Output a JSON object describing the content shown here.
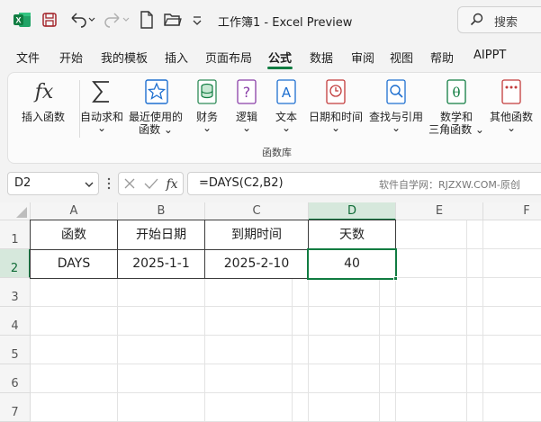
{
  "window": {
    "title": "工作簿1 - Excel Preview",
    "search_label": "搜索",
    "icons": [
      "excel-logo-icon",
      "save-icon",
      "undo-icon",
      "redo-icon",
      "new-file-icon",
      "open-folder-icon",
      "customize-qat-icon",
      "search-icon"
    ]
  },
  "menu": {
    "tabs": [
      "文件",
      "开始",
      "我的模板",
      "插入",
      "页面布局",
      "公式",
      "数据",
      "审阅",
      "视图",
      "帮助",
      "AIPPT"
    ],
    "active": "公式"
  },
  "ribbon": {
    "buttons": [
      {
        "label": "插入函数",
        "label2": "",
        "icon": "fx-icon"
      },
      {
        "label": "自动求和",
        "label2": "⌄",
        "icon": "sigma-icon"
      },
      {
        "label": "最近使用的",
        "label2": "函数 ⌄",
        "icon": "star-icon"
      },
      {
        "label": "财务",
        "label2": "⌄",
        "icon": "finance-icon"
      },
      {
        "label": "逻辑",
        "label2": "⌄",
        "icon": "logic-icon"
      },
      {
        "label": "文本",
        "label2": "⌄",
        "icon": "text-icon"
      },
      {
        "label": "日期和时间",
        "label2": "⌄",
        "icon": "clock-icon"
      },
      {
        "label": "查找与引用",
        "label2": "⌄",
        "icon": "lookup-icon"
      },
      {
        "label": "数学和",
        "label2": "三角函数 ⌄",
        "icon": "math-icon"
      },
      {
        "label": "其他函数",
        "label2": "⌄",
        "icon": "more-functions-icon"
      }
    ],
    "group_label": "函数库"
  },
  "formula_bar": {
    "name_box": "D2",
    "formula": "=DAYS(C2,B2)",
    "watermark": "软件自学网：RJZXW.COM-原创"
  },
  "sheet": {
    "columns": [
      "A",
      "B",
      "C",
      "D",
      "E",
      "F"
    ],
    "rows": [
      "1",
      "2",
      "3",
      "4",
      "5",
      "6",
      "7"
    ],
    "cells": {
      "A1": "函数",
      "B1": "开始日期",
      "C1": "到期时间",
      "D1": "天数",
      "A2": "DAYS",
      "B2": "2025-1-1",
      "C2": "2025-2-10",
      "D2": "40"
    },
    "selected_cell": "D2",
    "accent_color": "#107c41"
  }
}
